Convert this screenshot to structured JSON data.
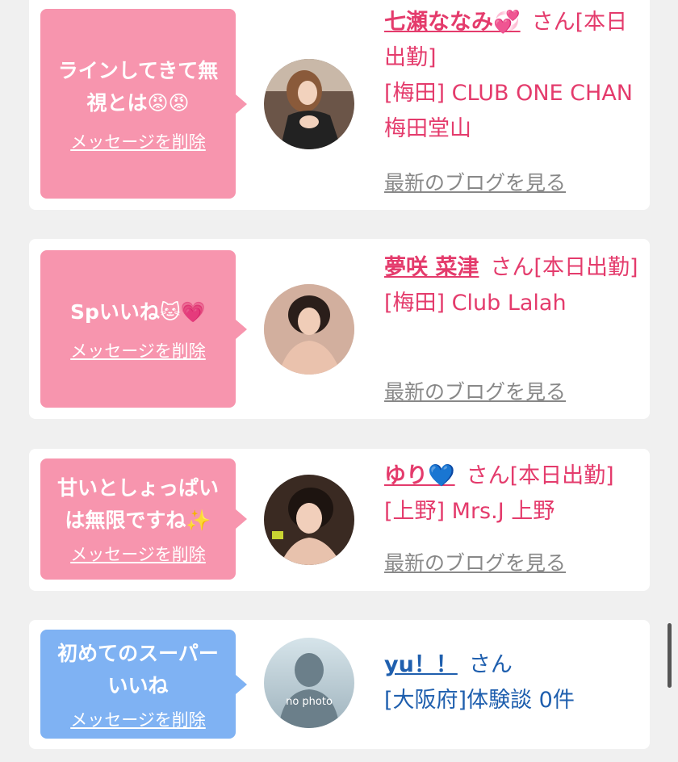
{
  "cards": [
    {
      "message": "ラインしてきて無視とは😡😡",
      "delete_label": "メッセージを削除",
      "name": "七瀬ななみ💞",
      "honorific": "さん[本日出勤]",
      "location": "[梅田] CLUB ONE CHAN 梅田堂山",
      "blog_label": "最新のブログを見る",
      "bubble_color": "#f795ae"
    },
    {
      "message": "Spいいね🐱💗",
      "delete_label": "メッセージを削除",
      "name": "夢咲 菜津",
      "honorific": "さん[本日出勤]",
      "location": "[梅田] Club Lalah",
      "blog_label": "最新のブログを見る",
      "bubble_color": "#f795ae"
    },
    {
      "message": "甘いとしょっぱいは無限ですね✨",
      "delete_label": "メッセージを削除",
      "name": "ゆり💙",
      "honorific": "さん[本日出勤]",
      "location": "[上野] Mrs.J 上野",
      "blog_label": "最新のブログを見る",
      "bubble_color": "#f795ae"
    },
    {
      "message": "初めてのスーパーいいね",
      "delete_label": "メッセージを削除",
      "name": "yu！！",
      "honorific": "さん",
      "location": "[大阪府]体験談 0件",
      "avatar_text": "no photo",
      "bubble_color": "#7fb2f3"
    }
  ],
  "colors": {
    "pink_text": "#e43b6c",
    "blue_text": "#1f5fae",
    "background": "#f0f0f0"
  }
}
